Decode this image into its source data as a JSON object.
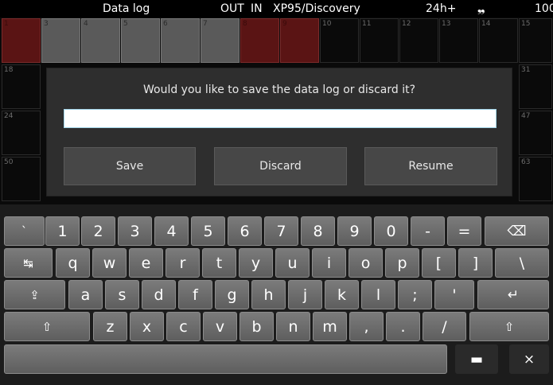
{
  "statusbar": {
    "title": "Data log",
    "out": "OUT",
    "in": "IN",
    "device": "XP95/Discovery",
    "mode": "24h+",
    "info_icon": "❠",
    "level": "100"
  },
  "grid": {
    "row1": [
      "1",
      "3",
      "4",
      "5",
      "6",
      "7",
      "8",
      "9",
      "10",
      "11",
      "12",
      "13",
      "14",
      "15"
    ],
    "row2_first": "18",
    "row2_last": "31",
    "row3_first": "24",
    "row3_last": "47",
    "row4_first": "50",
    "row4_last": "63"
  },
  "dialog": {
    "message": "Would you like to save the data log or discard it?",
    "input_value": "",
    "save_label": "Save",
    "discard_label": "Discard",
    "resume_label": "Resume"
  },
  "keyboard": {
    "row1": [
      "`",
      "1",
      "2",
      "3",
      "4",
      "5",
      "6",
      "7",
      "8",
      "9",
      "0",
      "-",
      "=",
      "⌫"
    ],
    "row2": [
      "↹",
      "q",
      "w",
      "e",
      "r",
      "t",
      "y",
      "u",
      "i",
      "o",
      "p",
      "[",
      "]",
      "\\"
    ],
    "row3": [
      "⇪",
      "a",
      "s",
      "d",
      "f",
      "g",
      "h",
      "j",
      "k",
      "l",
      ";",
      "'",
      "↵"
    ],
    "row4": [
      "⇧",
      "z",
      "x",
      "c",
      "v",
      "b",
      "n",
      "m",
      ",",
      ".",
      "/",
      "⇧"
    ],
    "row5": [
      "",
      "▬",
      "×"
    ]
  }
}
